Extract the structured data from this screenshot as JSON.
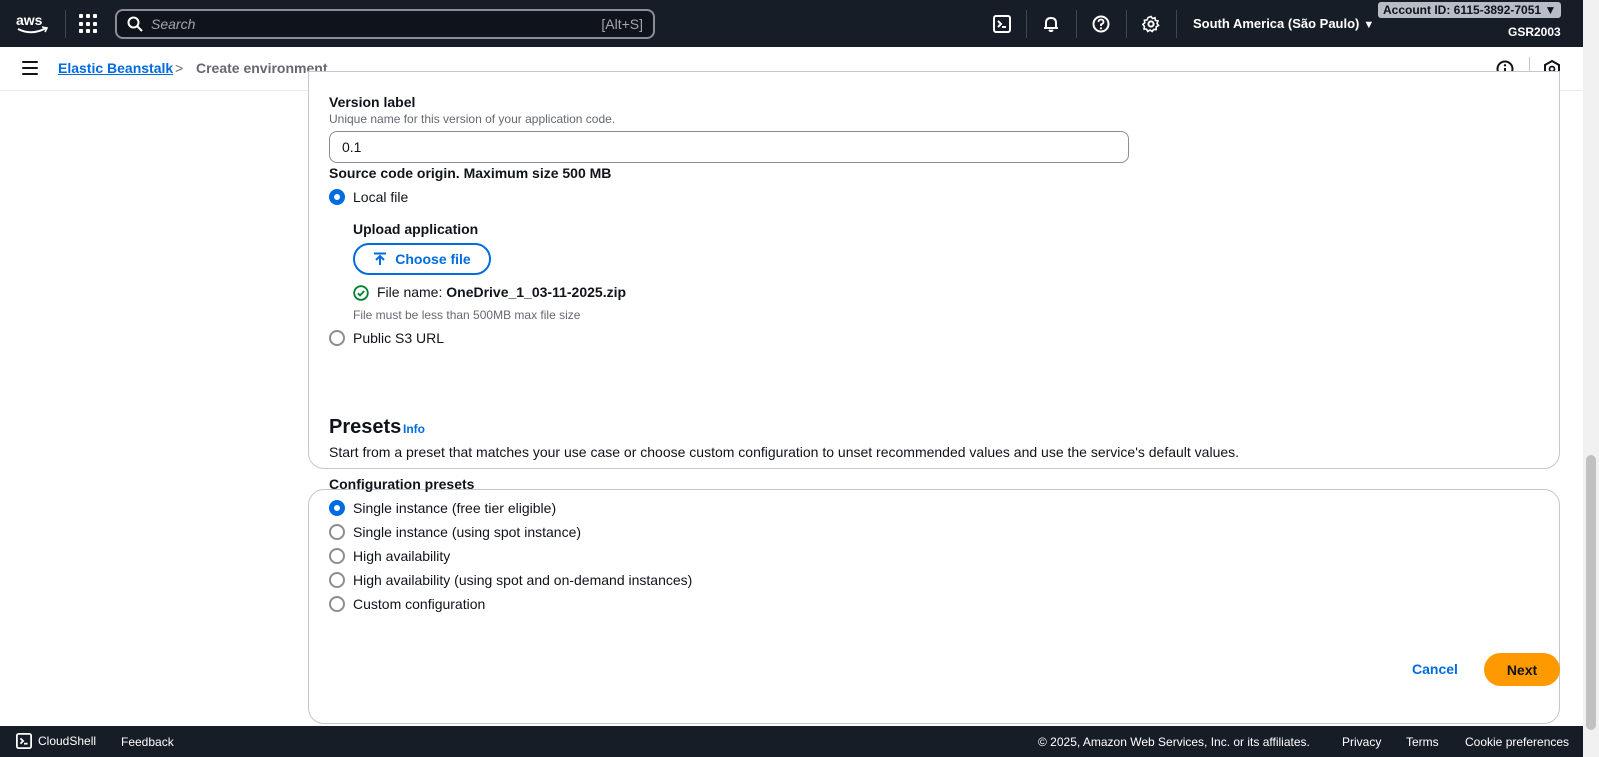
{
  "nav": {
    "search_placeholder": "Search",
    "search_shortcut": "[Alt+S]",
    "region": "South America (São Paulo)",
    "account": "Account ID: 6115-3892-7051",
    "user": "GSR2003",
    "icons": [
      "aws-logo",
      "apps-grid-icon",
      "search-icon",
      "cloudshell-icon",
      "bell-icon",
      "help-icon",
      "settings-icon"
    ]
  },
  "breadcrumb": {
    "parent": "Elastic Beanstalk",
    "current": "Create environment"
  },
  "source": {
    "version_label": "Version label",
    "version_desc": "Unique name for this version of your application code.",
    "version_value": "0.1",
    "origin_label": "Source code origin. Maximum size 500 MB",
    "local_file": "Local file",
    "upload_label": "Upload application",
    "choose_file": "Choose file",
    "file_name_prefix": "File name:",
    "file_name": "OneDrive_1_03-11-2025.zip",
    "file_hint": "File must be less than 500MB max file size",
    "public_s3": "Public S3 URL"
  },
  "presets": {
    "title": "Presets",
    "info": "Info",
    "description": "Start from a preset that matches your use case or choose custom configuration to unset recommended values and use the service's default values.",
    "group_label": "Configuration presets",
    "options": [
      "Single instance (free tier eligible)",
      "Single instance (using spot instance)",
      "High availability",
      "High availability (using spot and on-demand instances)",
      "Custom configuration"
    ],
    "selected": 0
  },
  "actions": {
    "cancel": "Cancel",
    "next": "Next"
  },
  "footer": {
    "cloudshell": "CloudShell",
    "feedback": "Feedback",
    "copyright": "© 2025, Amazon Web Services, Inc. or its affiliates.",
    "privacy": "Privacy",
    "terms": "Terms",
    "cookies": "Cookie preferences"
  },
  "colors": {
    "nav_bg": "#161d26",
    "link": "#006ce0",
    "primary_button": "#ff9900",
    "success": "#00802f"
  }
}
